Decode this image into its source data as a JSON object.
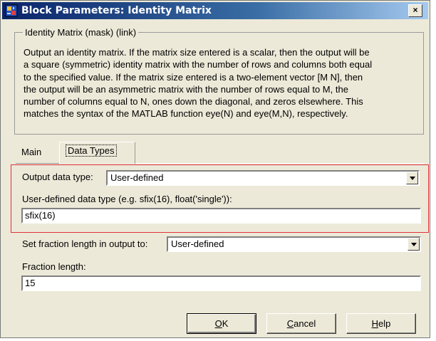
{
  "window": {
    "title": "Block Parameters: Identity Matrix",
    "close_glyph": "×",
    "app_icon": "simulink-block-icon"
  },
  "mask": {
    "legend": "Identity Matrix (mask) (link)",
    "description_lines": [
      "Output an identity matrix.  If the matrix size entered is a scalar, then the output will be",
      "a square (symmetric) identity matrix with the number of rows and columns both equal",
      "to the specified value.  If the matrix size entered is a two-element vector [M N], then",
      "the output will be an asymmetric matrix with the number of rows equal to M, the",
      "number of columns equal to N, ones down the diagonal, and zeros elsewhere.  This",
      "matches the syntax of the MATLAB function eye(N) and eye(M,N), respectively."
    ]
  },
  "tabs": [
    {
      "label": "Main",
      "active": false
    },
    {
      "label": "Data Types",
      "active": true
    }
  ],
  "params": {
    "output_data_type_label": "Output data type:",
    "output_data_type_value": "User-defined",
    "user_defined_type_label": "User-defined data type (e.g. sfix(16), float('single')):",
    "user_defined_type_value": "sfix(16)",
    "fraction_setting_label": "Set fraction length in output to:",
    "fraction_setting_value": "User-defined",
    "fraction_length_label": "Fraction length:",
    "fraction_length_value": "15"
  },
  "buttons": {
    "ok": {
      "accel": "O",
      "rest": "K"
    },
    "cancel": {
      "accel": "C",
      "rest": "ancel"
    },
    "help": {
      "accel": "H",
      "rest": "elp"
    }
  },
  "colors": {
    "dialog_bg": "#ece9d8",
    "title_start": "#0a246a",
    "title_end": "#a6caf0",
    "highlight": "#e0303c"
  }
}
